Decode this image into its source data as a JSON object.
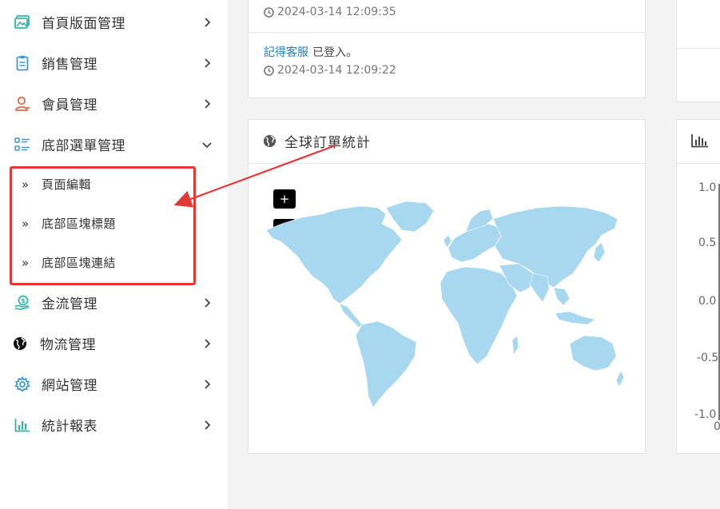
{
  "sidebar": {
    "items": [
      {
        "label": "首頁版面管理",
        "icon": "image-gallery-icon",
        "color": "#2fb5a8"
      },
      {
        "label": "銷售管理",
        "icon": "clipboard-icon",
        "color": "#3b9ad9"
      },
      {
        "label": "會員管理",
        "icon": "user-icon",
        "color": "#e8684a"
      },
      {
        "label": "底部選單管理",
        "icon": "list-icon",
        "color": "#3b9ad9"
      },
      {
        "label": "金流管理",
        "icon": "money-hand-icon",
        "color": "#2fb5a8"
      },
      {
        "label": "物流管理",
        "icon": "globe-icon",
        "color": "#111111"
      },
      {
        "label": "網站管理",
        "icon": "gear-icon",
        "color": "#3b9ad9"
      },
      {
        "label": "統計報表",
        "icon": "bar-chart-icon",
        "color": "#2fb5a8"
      }
    ],
    "submenu": [
      {
        "label": "頁面編輯"
      },
      {
        "label": "底部區塊標題"
      },
      {
        "label": "底部區塊連結"
      }
    ],
    "sub_arrow": "»"
  },
  "log": {
    "entries": [
      {
        "time": "2024-03-14 12:09:35"
      },
      {
        "user": "記得客服",
        "text": "已登入。",
        "time": "2024-03-14 12:09:22"
      }
    ]
  },
  "map_panel": {
    "title": "全球訂單統計",
    "zoom_in": "+",
    "zoom_out": "−",
    "map_color": "#a8d8f0"
  },
  "chart_panel": {
    "y_ticks": [
      "1.0",
      "0.5",
      "0.0",
      "-0.5",
      "-1.0"
    ],
    "x_tick": "0"
  },
  "colors": {
    "annotation": "#e53935",
    "link": "#1f7fc0"
  }
}
